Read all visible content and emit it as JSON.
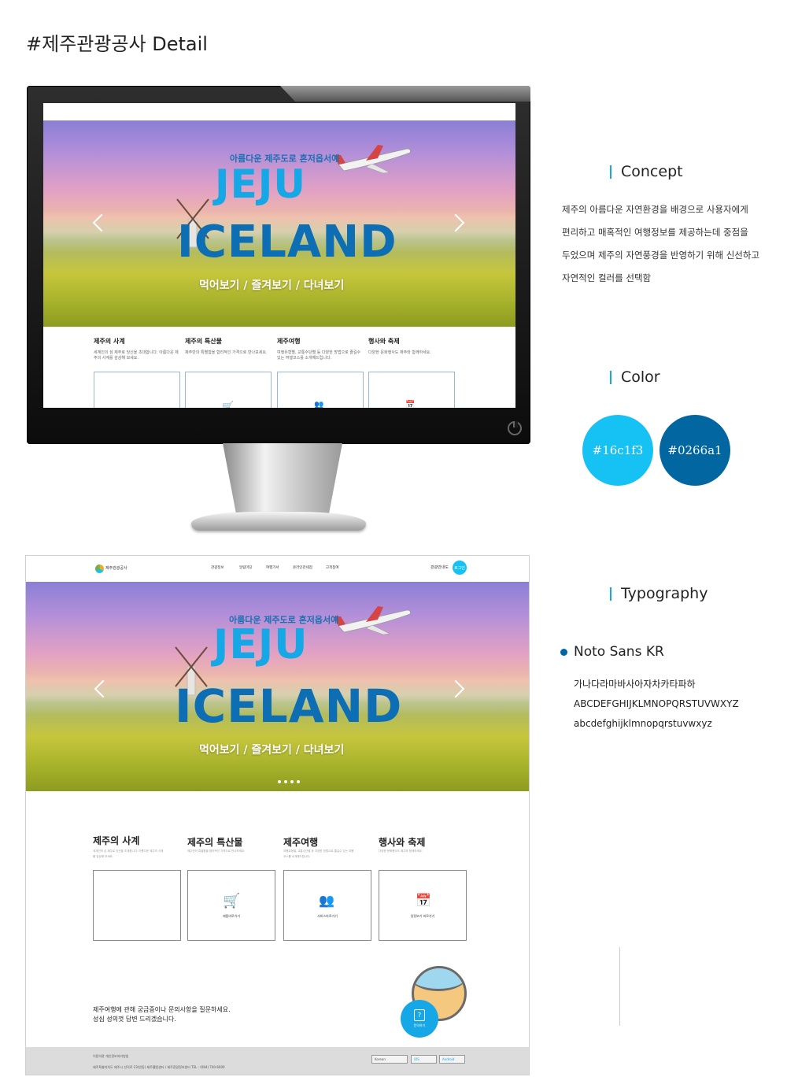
{
  "page": {
    "title": "#제주관광공사 Detail"
  },
  "hero": {
    "subtitle": "아름다운 제주도로 혼저옵서예",
    "word1": "JEJU",
    "word2": "ICELAND",
    "tagline": "먹어보기 / 즐겨보기 / 다녀보기"
  },
  "nav": {
    "logo": "제주관광공사",
    "menu": [
      "관광정보",
      "알림마당",
      "여행가서",
      "온라인관세점",
      "고객참여"
    ],
    "lang": "관광안내도",
    "login": "로그인"
  },
  "sections": [
    {
      "title": "제주의 사계",
      "desc": "세계인의 섬 제주로 당신을 초대합니다. 아름다운 제주의 사계를 감상해 보세요.",
      "button": ""
    },
    {
      "title": "제주의 특산물",
      "desc": "제주만의 특별함을 합리적인 가격으로 만나보세요.",
      "button": "제품바로가기"
    },
    {
      "title": "제주여행",
      "desc": "여행유형별, 교통수단별 등 다양한 방법으로 즐길수 있는 여행코스를 소개해드립니다.",
      "button": "서비스바로가기"
    },
    {
      "title": "행사와 축제",
      "desc": "다양한 문화행사도 제주와 함께하세요.",
      "button": "일정보기 바로가기"
    }
  ],
  "inquiry": {
    "line1": "제주여행에 관해 궁금증이나 문의사항을 질문하세요.",
    "line2": "성심 성의껏 답변 드리겠습니다.",
    "button": "문의하기"
  },
  "footer": {
    "links": "이용약관   개인정보처리방침",
    "address": "제주특별자치도  제주시  선덕로 23(연동)  제주웰컴센터 / 제주관광정보센터  TEL : (064) 740-6000",
    "language": "Korean",
    "ios": "iOS",
    "android": "Android"
  },
  "concept": {
    "heading": "Concept",
    "lines": [
      "제주의 아름다운 자연환경을 배경으로 사용자에게",
      "편리하고 매혹적인 여행정보를 제공하는데 중점을",
      "두었으며 제주의 자연풍경을 반영하기 위해 신선하고",
      "자연적인 컬러를 선택함"
    ]
  },
  "color": {
    "heading": "Color",
    "swatches": [
      {
        "label": "#16c1f3",
        "hex": "#16c1f3"
      },
      {
        "label": "#0266a1",
        "hex": "#0266a1"
      }
    ]
  },
  "typography": {
    "heading": "Typography",
    "font_name": "Noto Sans KR",
    "samples": [
      "가나다라마바사아자차카타파하",
      "ABCDEFGHIJKLMNOPQRSTUVWXYZ",
      "abcdefghijklmnopqrstuvwxyz"
    ]
  }
}
